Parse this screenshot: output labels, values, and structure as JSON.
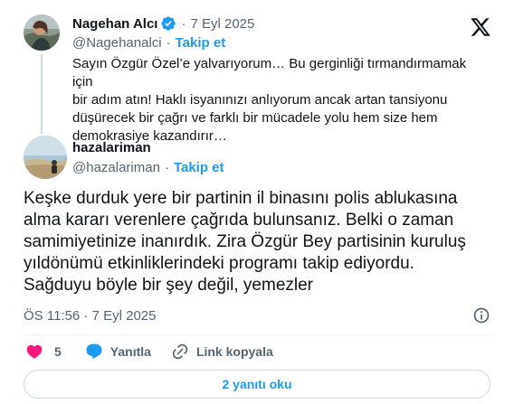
{
  "quoted": {
    "name": "Nagehan Alcı",
    "handle": "@Nagehanalci",
    "separator": "·",
    "date": "7 Eyl 2025",
    "follow_label": "Takip et",
    "text": "Sayın Özgür Özel’e yalvarıyorum… Bu gerginliği tırmandırmamak için\nbir adım atın! Haklı isyanınızı anlıyorum ancak artan tansiyonu\ndüşürecek bir çağrı ve farklı bir mücadele yolu hem size hem\ndemokrasiye kazandırır…"
  },
  "tweet": {
    "name": "hazalariman",
    "handle": "@hazalariman",
    "separator": "·",
    "follow_label": "Takip et",
    "text": "Keşke durduk yere bir partinin il binasını polis ablukasına\nalma kararı verenlere çağrıda bulunsanız. Belki o zaman\nsamimiyetinize inanırdık. Zira Özgür Bey partisinin kuruluş\nyıldönümü etkinliklerindeki programı takip ediyordu.\nSağduyu böyle bir şey değil, yemezler",
    "timestamp": "ÖS 11:56 · 7 Eyl 2025"
  },
  "actions": {
    "likes": "5",
    "reply_label": "Yanıtla",
    "copy_link_label": "Link kopyala"
  },
  "read_replies_label": "2 yanıtı oku",
  "colors": {
    "accent": "#1d9bf0",
    "like": "#f91880",
    "muted": "#536471",
    "text": "#0f1419",
    "border": "#cfd9de"
  },
  "icons": [
    "x-logo-icon",
    "verified-badge-icon",
    "heart-icon",
    "reply-bubble-icon",
    "link-icon",
    "info-icon"
  ]
}
